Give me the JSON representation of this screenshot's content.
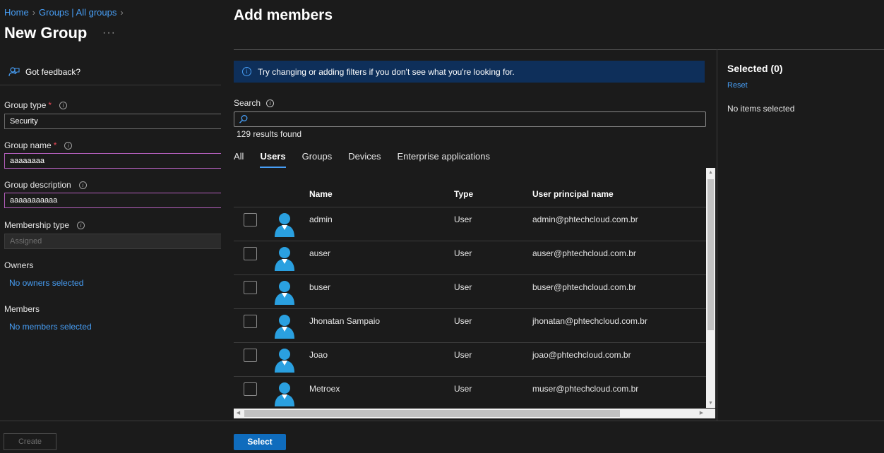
{
  "breadcrumb": {
    "home": "Home",
    "groups": "Groups | All groups"
  },
  "page": {
    "title": "New Group",
    "more": "···"
  },
  "feedback": {
    "label": "Got feedback?"
  },
  "form": {
    "group_type": {
      "label": "Group type",
      "required": "*",
      "value": "Security"
    },
    "group_name": {
      "label": "Group name",
      "required": "*",
      "value": "aaaaaaaa"
    },
    "group_description": {
      "label": "Group description",
      "value": "aaaaaaaaaaa"
    },
    "membership_type": {
      "label": "Membership type",
      "value": "Assigned"
    },
    "owners": {
      "label": "Owners",
      "link": "No owners selected"
    },
    "members": {
      "label": "Members",
      "link": "No members selected"
    },
    "create_label": "Create"
  },
  "panel": {
    "title": "Add members",
    "info": "Try changing or adding filters if you don't see what you're looking for.",
    "search": {
      "label": "Search",
      "placeholder": ""
    },
    "results": "129 results found",
    "tabs": [
      "All",
      "Users",
      "Groups",
      "Devices",
      "Enterprise applications"
    ],
    "active_tab": "Users",
    "columns": {
      "name": "Name",
      "type": "Type",
      "upn": "User principal name"
    },
    "rows": [
      {
        "name": "admin",
        "type": "User",
        "upn": "admin@phtechcloud.com.br"
      },
      {
        "name": "auser",
        "type": "User",
        "upn": "auser@phtechcloud.com.br"
      },
      {
        "name": "buser",
        "type": "User",
        "upn": "buser@phtechcloud.com.br"
      },
      {
        "name": "Jhonatan Sampaio",
        "type": "User",
        "upn": "jhonatan@phtechcloud.com.br"
      },
      {
        "name": "Joao",
        "type": "User",
        "upn": "joao@phtechcloud.com.br"
      },
      {
        "name": "Metroex",
        "type": "User",
        "upn": "muser@phtechcloud.com.br"
      }
    ],
    "selected": {
      "title": "Selected (0)",
      "reset": "Reset",
      "empty": "No items selected"
    },
    "select_label": "Select"
  },
  "colors": {
    "accent": "#479ef5",
    "primary_button": "#0f6cbd",
    "info_bar": "#0e2f5a",
    "required": "#e74856",
    "avatar": "#2aa0e0"
  }
}
